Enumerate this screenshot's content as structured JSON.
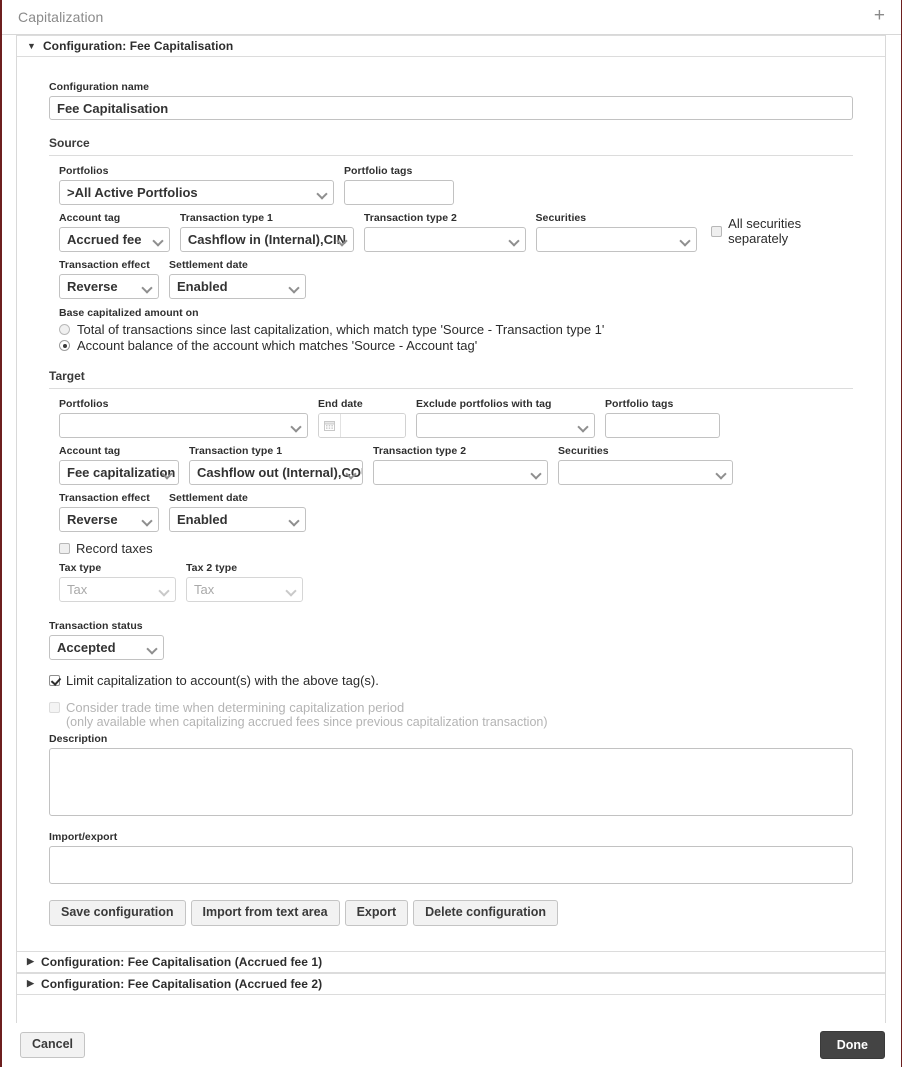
{
  "window": {
    "title": "Capitalization",
    "add_icon": "plus-icon"
  },
  "accordions": [
    {
      "label": "Configuration: Fee Capitalisation",
      "expanded": true,
      "marker": "▼"
    },
    {
      "label": "Configuration: Fee Capitalisation (Accrued fee 1)",
      "expanded": false,
      "marker": "▶"
    },
    {
      "label": "Configuration: Fee Capitalisation (Accrued fee 2)",
      "expanded": false,
      "marker": "▶"
    }
  ],
  "form": {
    "configuration_name_label": "Configuration name",
    "configuration_name_value": "Fee Capitalisation",
    "source": {
      "title": "Source",
      "portfolios_label": "Portfolios",
      "portfolios_value": ">All Active Portfolios",
      "portfolio_tags_label": "Portfolio tags",
      "portfolio_tags_value": "",
      "account_tag_label": "Account tag",
      "account_tag_value": "Accrued fee",
      "transaction_type_1_label": "Transaction type 1",
      "transaction_type_1_value": "Cashflow in (Internal),CIN",
      "transaction_type_2_label": "Transaction type 2",
      "transaction_type_2_value": "",
      "securities_label": "Securities",
      "securities_value": "",
      "all_securities_label": "All securities separately",
      "all_securities_checked": false,
      "transaction_effect_label": "Transaction effect",
      "transaction_effect_value": "Reverse",
      "settlement_date_label": "Settlement date",
      "settlement_date_value": "Enabled",
      "base_amount_label": "Base capitalized amount on",
      "base_amount_options": [
        {
          "label": "Total of transactions since last capitalization, which match type 'Source - Transaction type 1'",
          "selected": false
        },
        {
          "label": "Account balance of the account which matches 'Source - Account tag'",
          "selected": true
        }
      ]
    },
    "target": {
      "title": "Target",
      "portfolios_label": "Portfolios",
      "portfolios_value": "",
      "end_date_label": "End date",
      "end_date_value": "",
      "end_date_icon": "calendar-icon",
      "exclude_portfolios_label": "Exclude portfolios with tag",
      "exclude_portfolios_value": "",
      "portfolio_tags_label": "Portfolio tags",
      "portfolio_tags_value": "",
      "account_tag_label": "Account tag",
      "account_tag_value": "Fee capitalization",
      "transaction_type_1_label": "Transaction type 1",
      "transaction_type_1_value": "Cashflow out (Internal),COUT",
      "transaction_type_2_label": "Transaction type 2",
      "transaction_type_2_value": "",
      "securities_label": "Securities",
      "securities_value": "",
      "transaction_effect_label": "Transaction effect",
      "transaction_effect_value": "Reverse",
      "settlement_date_label": "Settlement date",
      "settlement_date_value": "Enabled",
      "record_taxes_label": "Record taxes",
      "record_taxes_checked": false,
      "tax_type_label": "Tax type",
      "tax_type_value": "Tax",
      "tax_2_type_label": "Tax 2 type",
      "tax_2_type_value": "Tax"
    },
    "transaction_status_label": "Transaction status",
    "transaction_status_value": "Accepted",
    "limit_capitalization_label": "Limit capitalization to account(s) with the above tag(s).",
    "limit_capitalization_checked": true,
    "consider_trade_time_label": "Consider trade time when determining capitalization period",
    "consider_trade_time_sub": "(only available when capitalizing accrued fees since previous capitalization transaction)",
    "consider_trade_time_checked": false,
    "description_label": "Description",
    "description_value": "",
    "import_export_label": "Import/export",
    "import_export_value": "",
    "buttons": [
      "Save configuration",
      "Import from text area",
      "Export",
      "Delete configuration"
    ]
  },
  "footer": {
    "cancel_label": "Cancel",
    "done_label": "Done"
  },
  "colors": {
    "accent_border": "#6d1f1f",
    "done_button": "#444444",
    "field_border": "#c2c2c2"
  }
}
